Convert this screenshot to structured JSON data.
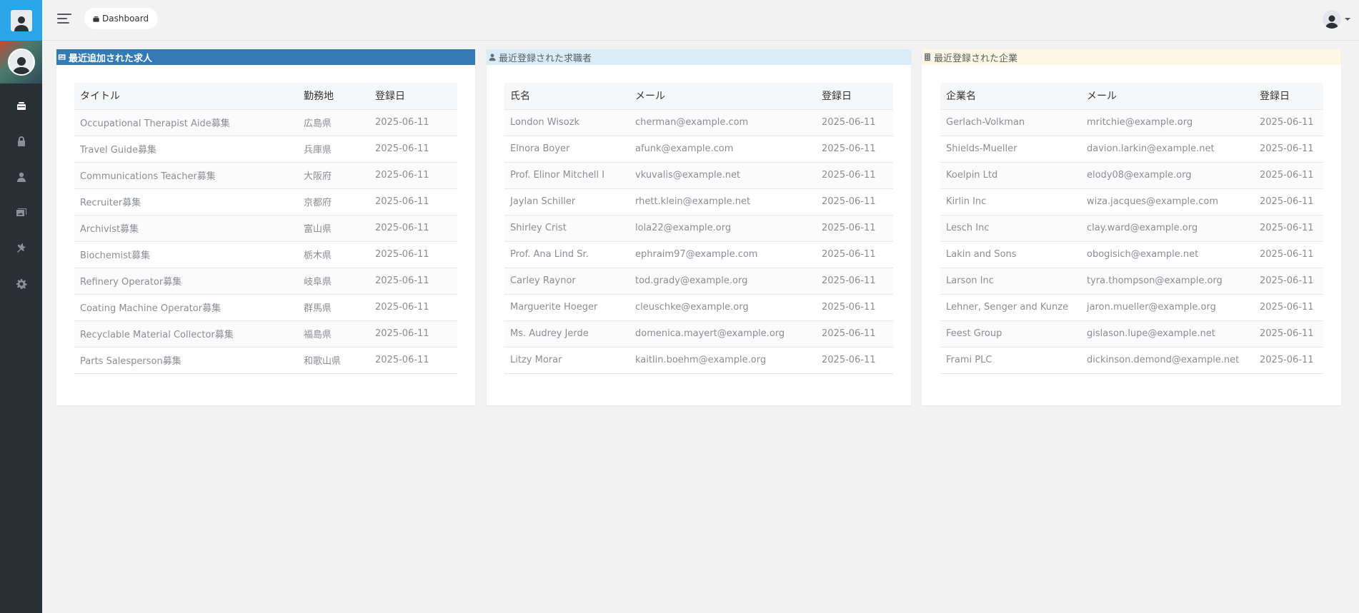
{
  "header": {
    "breadcrumb": "Dashboard"
  },
  "sidebar": {
    "items": [
      {
        "icon": "dashboard-icon",
        "active": true
      },
      {
        "icon": "lock-icon"
      },
      {
        "icon": "user-icon"
      },
      {
        "icon": "images-icon"
      },
      {
        "icon": "tools-icon"
      },
      {
        "icon": "gear-icon"
      }
    ]
  },
  "jobs": {
    "title": "最近追加された求人",
    "columns": [
      "タイトル",
      "勤務地",
      "登録日"
    ],
    "rows": [
      [
        "Occupational Therapist Aide募集",
        "広島県",
        "2025-06-11"
      ],
      [
        "Travel Guide募集",
        "兵庫県",
        "2025-06-11"
      ],
      [
        "Communications Teacher募集",
        "大阪府",
        "2025-06-11"
      ],
      [
        "Recruiter募集",
        "京都府",
        "2025-06-11"
      ],
      [
        "Archivist募集",
        "富山県",
        "2025-06-11"
      ],
      [
        "Biochemist募集",
        "栃木県",
        "2025-06-11"
      ],
      [
        "Refinery Operator募集",
        "岐阜県",
        "2025-06-11"
      ],
      [
        "Coating Machine Operator募集",
        "群馬県",
        "2025-06-11"
      ],
      [
        "Recyclable Material Collector募集",
        "福島県",
        "2025-06-11"
      ],
      [
        "Parts Salesperson募集",
        "和歌山県",
        "2025-06-11"
      ]
    ]
  },
  "seekers": {
    "title": "最近登録された求職者",
    "columns": [
      "氏名",
      "メール",
      "登録日"
    ],
    "rows": [
      [
        "London Wisozk",
        "cherman@example.com",
        "2025-06-11"
      ],
      [
        "Elnora Boyer",
        "afunk@example.com",
        "2025-06-11"
      ],
      [
        "Prof. Elinor Mitchell I",
        "vkuvalis@example.net",
        "2025-06-11"
      ],
      [
        "Jaylan Schiller",
        "rhett.klein@example.net",
        "2025-06-11"
      ],
      [
        "Shirley Crist",
        "lola22@example.org",
        "2025-06-11"
      ],
      [
        "Prof. Ana Lind Sr.",
        "ephraim97@example.com",
        "2025-06-11"
      ],
      [
        "Carley Raynor",
        "tod.grady@example.org",
        "2025-06-11"
      ],
      [
        "Marguerite Hoeger",
        "cleuschke@example.org",
        "2025-06-11"
      ],
      [
        "Ms. Audrey Jerde",
        "domenica.mayert@example.org",
        "2025-06-11"
      ],
      [
        "Litzy Morar",
        "kaitlin.boehm@example.org",
        "2025-06-11"
      ]
    ]
  },
  "companies": {
    "title": "最近登録された企業",
    "columns": [
      "企業名",
      "メール",
      "登録日"
    ],
    "rows": [
      [
        "Gerlach-Volkman",
        "mritchie@example.org",
        "2025-06-11"
      ],
      [
        "Shields-Mueller",
        "davion.larkin@example.net",
        "2025-06-11"
      ],
      [
        "Koelpin Ltd",
        "elody08@example.org",
        "2025-06-11"
      ],
      [
        "Kirlin Inc",
        "wiza.jacques@example.com",
        "2025-06-11"
      ],
      [
        "Lesch Inc",
        "clay.ward@example.org",
        "2025-06-11"
      ],
      [
        "Lakin and Sons",
        "obogisich@example.net",
        "2025-06-11"
      ],
      [
        "Larson Inc",
        "tyra.thompson@example.org",
        "2025-06-11"
      ],
      [
        "Lehner, Senger and Kunze",
        "jaron.mueller@example.org",
        "2025-06-11"
      ],
      [
        "Feest Group",
        "gislason.lupe@example.net",
        "2025-06-11"
      ],
      [
        "Frami PLC",
        "dickinson.demond@example.net",
        "2025-06-11"
      ]
    ]
  }
}
